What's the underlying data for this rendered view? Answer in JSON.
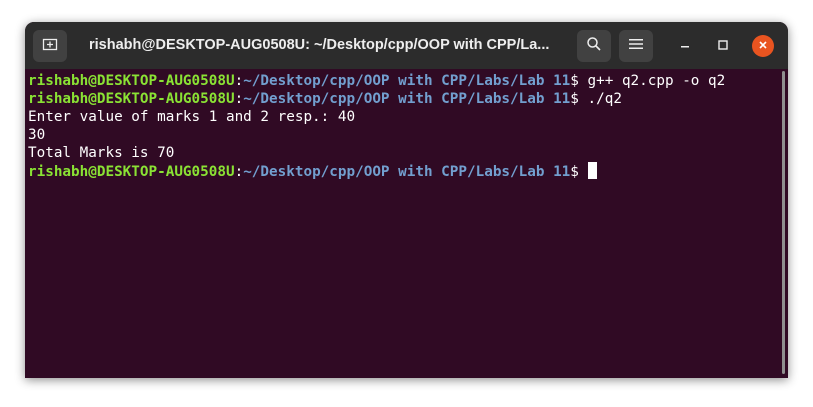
{
  "window": {
    "title": "rishabh@DESKTOP-AUG0508U: ~/Desktop/cpp/OOP with CPP/La..."
  },
  "icons": {
    "new_tab": "new-tab-icon",
    "search": "search-icon",
    "menu": "hamburger-menu-icon",
    "minimize": "minimize-icon",
    "maximize": "maximize-icon",
    "close": "close-icon"
  },
  "colors": {
    "background": "#300a24",
    "titlebar": "#2c2c2c",
    "user_host": "#8ae234",
    "path": "#729fcf",
    "close_button": "#e95420"
  },
  "terminal": {
    "prompt_user": "rishabh@DESKTOP-AUG0508U",
    "prompt_colon": ":",
    "prompt_path": "~/Desktop/cpp/OOP with CPP/Labs/Lab 11",
    "prompt_symbol": "$ ",
    "commands": [
      "g++ q2.cpp -o q2",
      "./q2"
    ],
    "output": [
      "Enter value of marks 1 and 2 resp.: 40",
      "30",
      "Total Marks is 70"
    ]
  }
}
